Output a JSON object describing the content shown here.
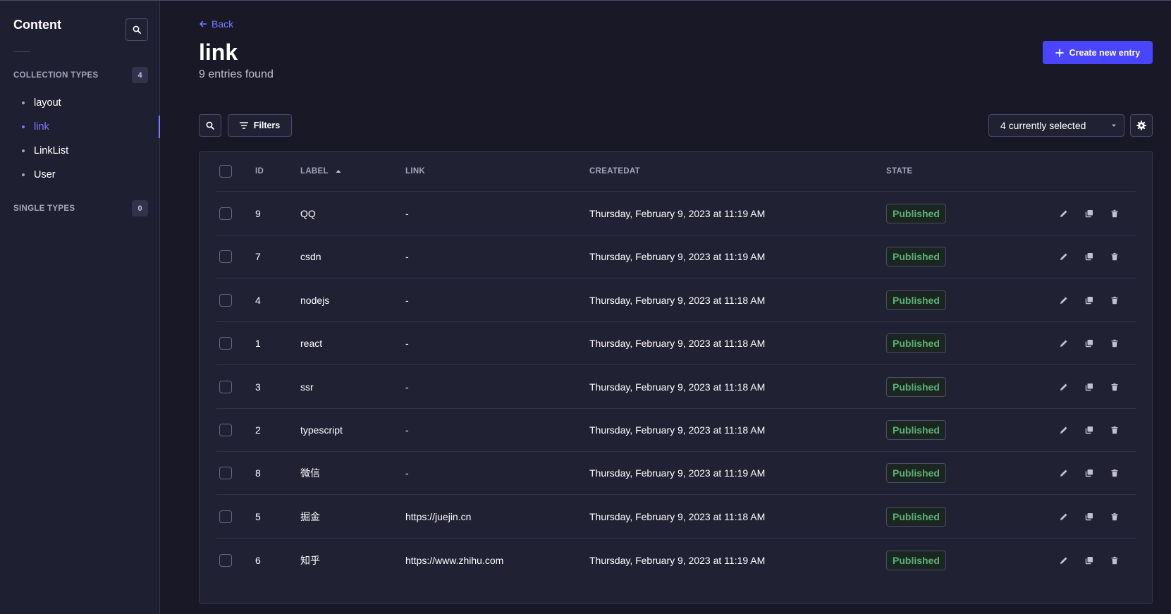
{
  "sidebar": {
    "title": "Content",
    "collection_types_label": "COLLECTION TYPES",
    "collection_types_count": "4",
    "items": [
      {
        "label": "layout"
      },
      {
        "label": "link"
      },
      {
        "label": "LinkList"
      },
      {
        "label": "User"
      }
    ],
    "single_types_label": "SINGLE TYPES",
    "single_types_count": "0"
  },
  "header": {
    "back_label": "Back",
    "title": "link",
    "subtitle": "9 entries found",
    "create_label": "Create new entry"
  },
  "toolbar": {
    "filters_label": "Filters",
    "columns_selected": "4 currently selected"
  },
  "table": {
    "columns": {
      "id": "ID",
      "label": "LABEL",
      "link": "LINK",
      "createdat": "CREATEDAT",
      "state": "STATE"
    },
    "rows": [
      {
        "id": "9",
        "label": "QQ",
        "link": "-",
        "created": "Thursday, February 9, 2023 at 11:19 AM",
        "state": "Published"
      },
      {
        "id": "7",
        "label": "csdn",
        "link": "-",
        "created": "Thursday, February 9, 2023 at 11:19 AM",
        "state": "Published"
      },
      {
        "id": "4",
        "label": "nodejs",
        "link": "-",
        "created": "Thursday, February 9, 2023 at 11:18 AM",
        "state": "Published"
      },
      {
        "id": "1",
        "label": "react",
        "link": "-",
        "created": "Thursday, February 9, 2023 at 11:18 AM",
        "state": "Published"
      },
      {
        "id": "3",
        "label": "ssr",
        "link": "-",
        "created": "Thursday, February 9, 2023 at 11:18 AM",
        "state": "Published"
      },
      {
        "id": "2",
        "label": "typescript",
        "link": "-",
        "created": "Thursday, February 9, 2023 at 11:18 AM",
        "state": "Published"
      },
      {
        "id": "8",
        "label": "微信",
        "link": "-",
        "created": "Thursday, February 9, 2023 at 11:19 AM",
        "state": "Published"
      },
      {
        "id": "5",
        "label": "掘金",
        "link": "https://juejin.cn",
        "created": "Thursday, February 9, 2023 at 11:18 AM",
        "state": "Published"
      },
      {
        "id": "6",
        "label": "知乎",
        "link": "https://www.zhihu.com",
        "created": "Thursday, February 9, 2023 at 11:19 AM",
        "state": "Published"
      }
    ]
  },
  "colors": {
    "accent": "#7b79ff",
    "primary_button": "#4945ff",
    "published": "#5cb176",
    "background": "#181826",
    "panel": "#212134"
  },
  "icons": {
    "search": "search-icon",
    "filter": "filter-icon",
    "settings": "gear-icon",
    "edit": "pencil-icon",
    "duplicate": "duplicate-icon",
    "delete": "trash-icon",
    "back": "arrow-left-icon",
    "plus": "plus-icon",
    "sort": "sort-up-icon",
    "caret": "caret-down-icon"
  }
}
